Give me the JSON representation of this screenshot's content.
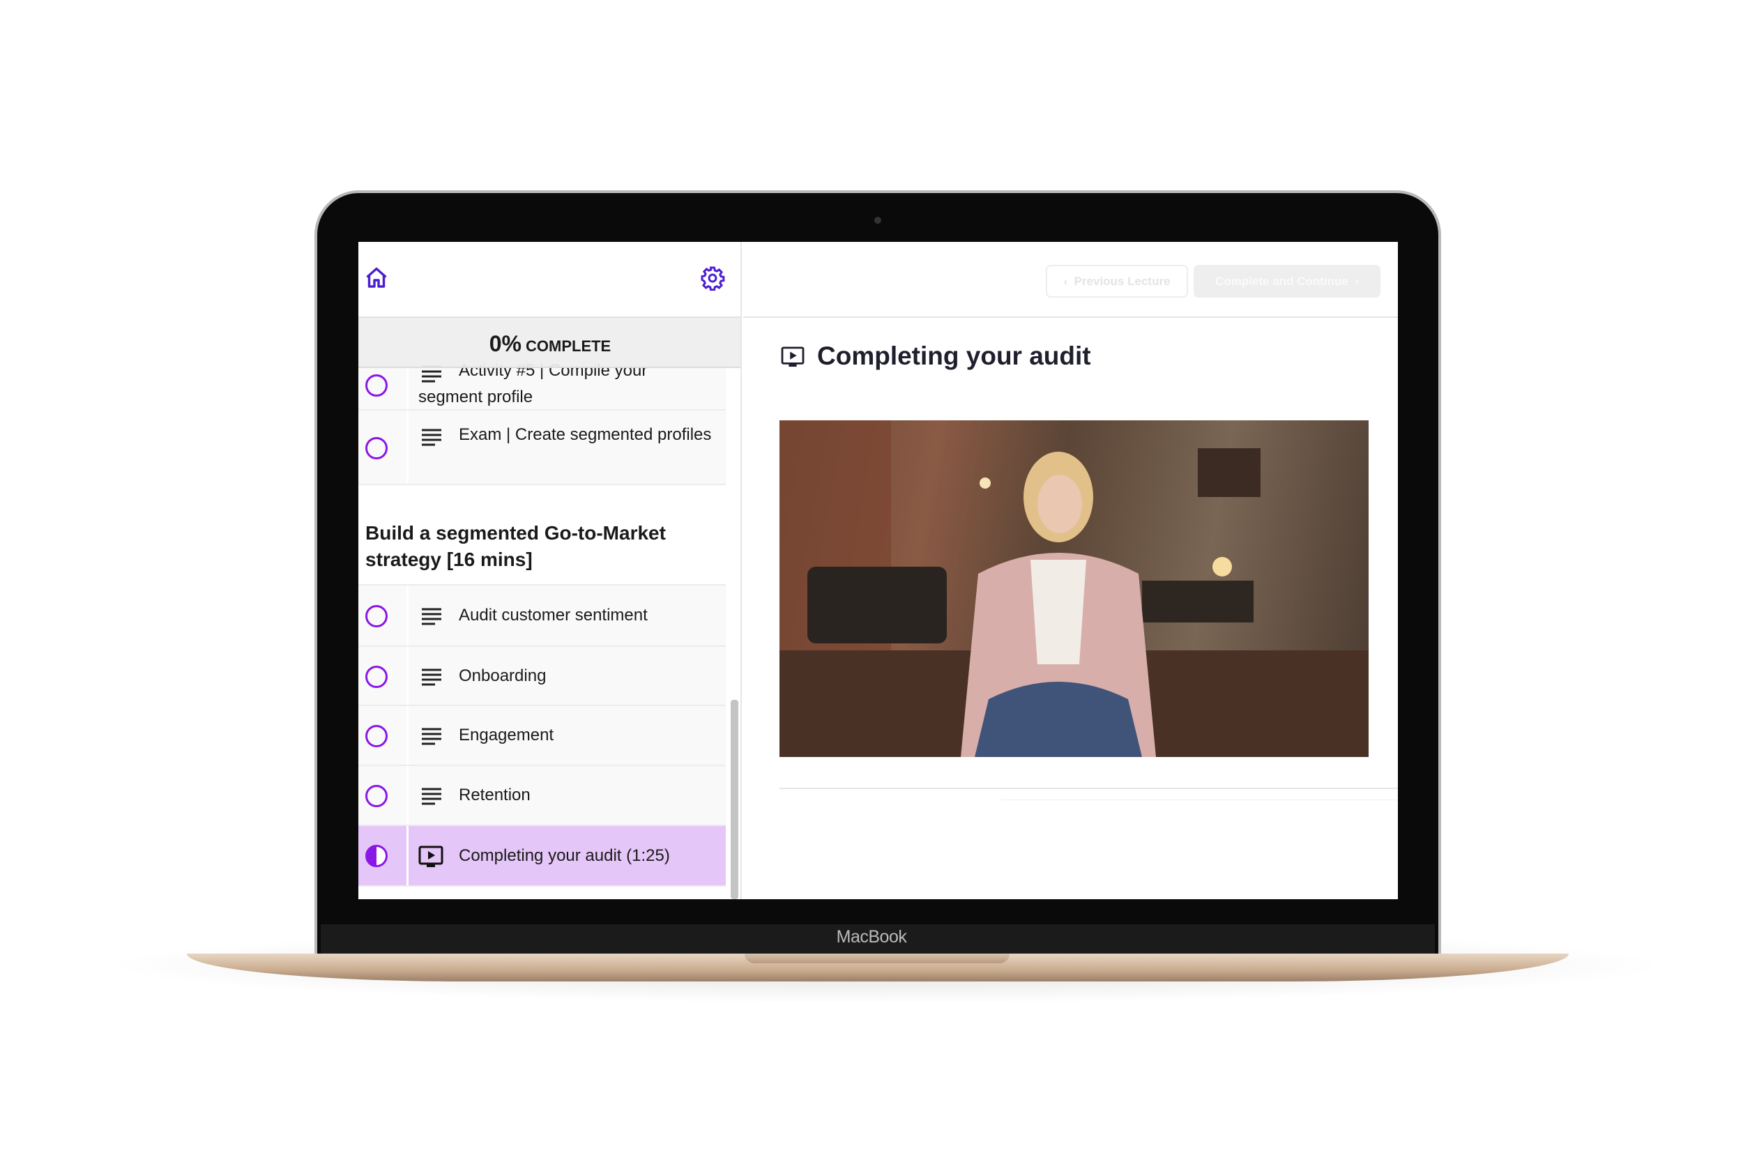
{
  "device": {
    "brand": "MacBook"
  },
  "sidebar": {
    "home_icon": "home-icon",
    "settings_icon": "gear-icon",
    "progress": {
      "percent": "0%",
      "label": "COMPLETE",
      "value": 0
    },
    "items": [
      {
        "label": "Activity #5 | Compile your segment profile",
        "icon": "text-lines-icon",
        "status": "not-started"
      },
      {
        "label": "Exam | Create segmented profiles",
        "icon": "text-lines-icon",
        "status": "not-started"
      }
    ],
    "section": {
      "title": "Build a segmented Go-to-Market strategy [16 mins]",
      "items": [
        {
          "label": "Audit customer sentiment",
          "icon": "text-lines-icon",
          "status": "not-started"
        },
        {
          "label": "Onboarding",
          "icon": "text-lines-icon",
          "status": "not-started"
        },
        {
          "label": "Engagement",
          "icon": "text-lines-icon",
          "status": "not-started"
        },
        {
          "label": "Retention",
          "icon": "text-lines-icon",
          "status": "not-started"
        },
        {
          "label": "Completing your audit (1:25)",
          "icon": "video-icon",
          "status": "in-progress",
          "active": true
        }
      ]
    }
  },
  "main": {
    "prev_button": "Previous Lecture",
    "next_button": "Complete and Continue",
    "lecture_title": "Completing your audit",
    "lecture_icon": "video-icon"
  },
  "colors": {
    "accent": "#8a17e8",
    "icon": "#4b1fd1",
    "active_row": "#e5c6f8"
  }
}
